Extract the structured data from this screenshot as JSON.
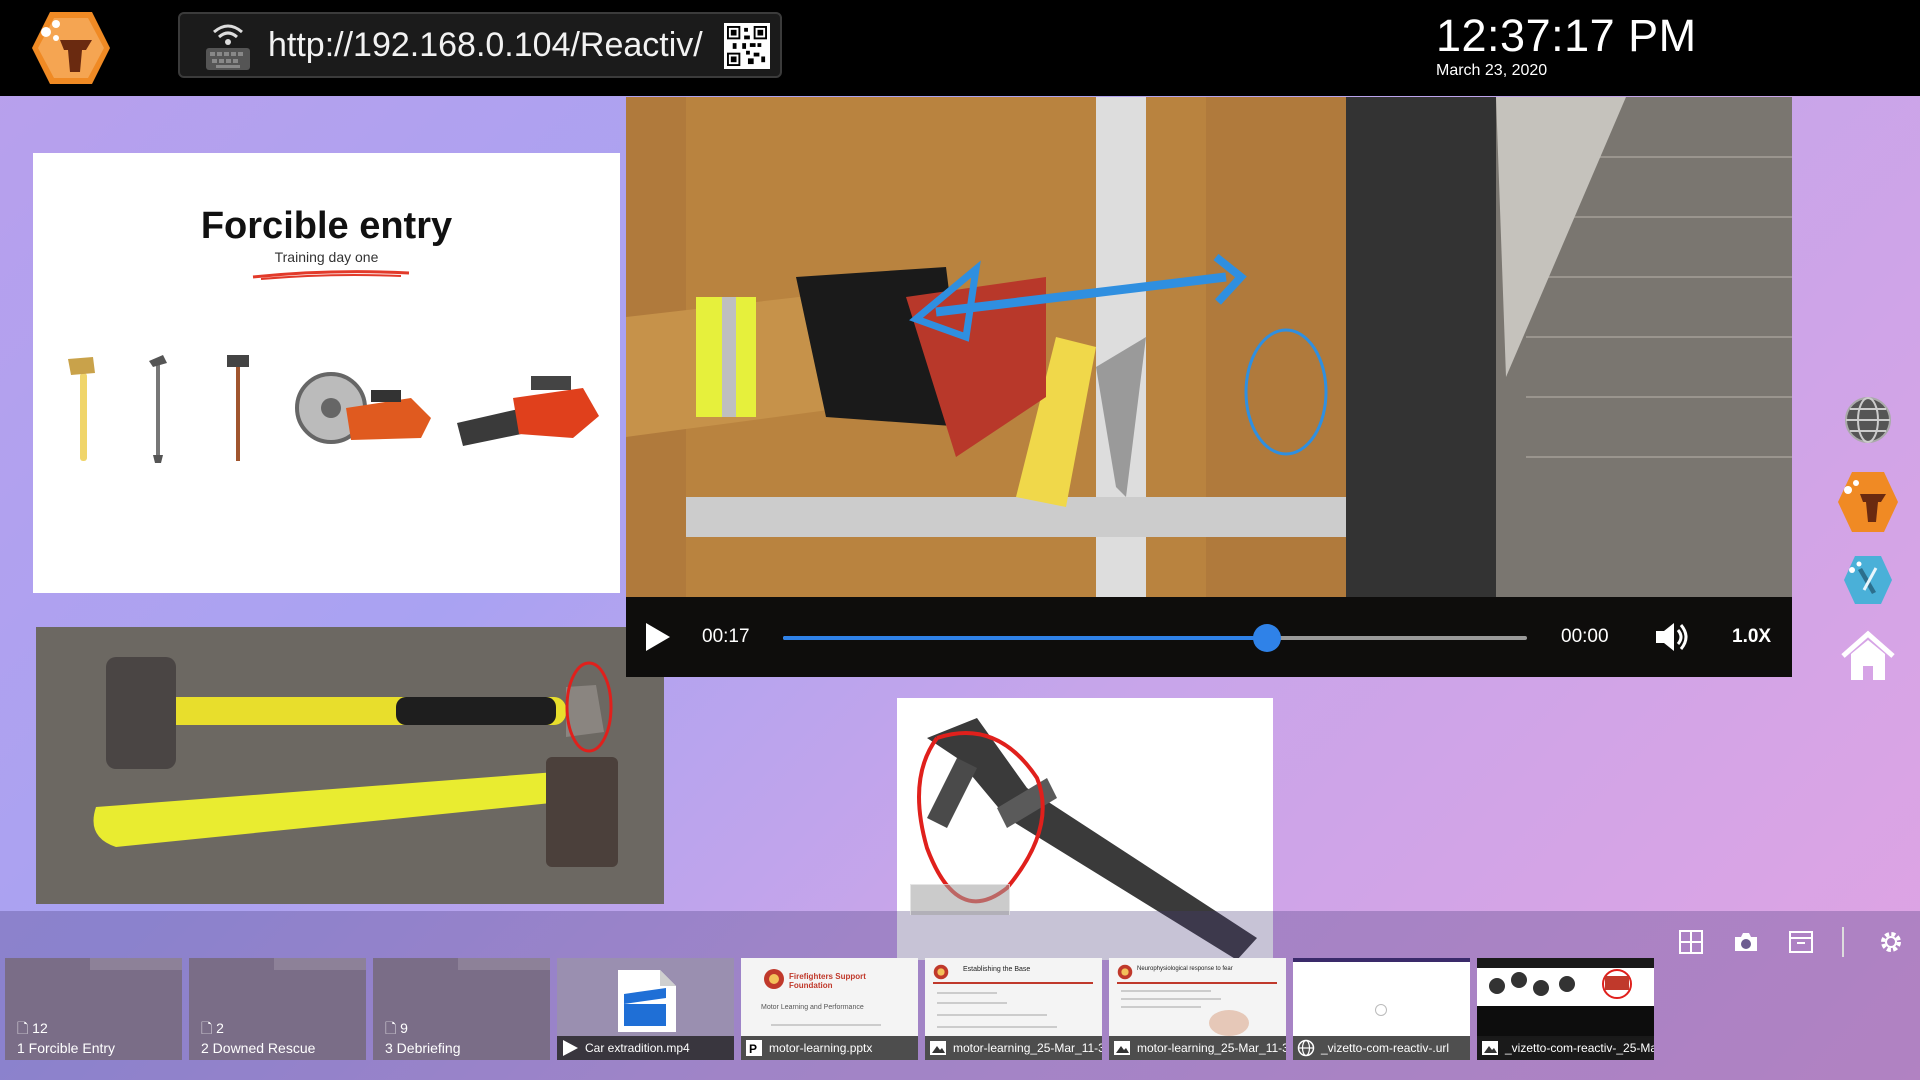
{
  "topbar": {
    "url": "http://192.168.0.104/Reactiv/",
    "time": "12:37:17 PM",
    "date": "March 23, 2020"
  },
  "slide": {
    "title": "Forcible entry",
    "subtitle": "Training day one"
  },
  "video": {
    "current_time": "00:17",
    "total_time": "00:00",
    "speed": "1.0X",
    "progress_percent": 65
  },
  "tray": {
    "folders": [
      {
        "count": "12",
        "name": "1 Forcible Entry"
      },
      {
        "count": "2",
        "name": "2 Downed Rescue"
      },
      {
        "count": "9",
        "name": "3 Debriefing"
      }
    ],
    "files": [
      {
        "name": "Car extradition.mp4",
        "icon": "play-icon"
      },
      {
        "name": "motor-learning.pptx",
        "icon": "powerpoint-icon"
      },
      {
        "name": "motor-learning_25-Mar_11-3",
        "icon": "image-icon"
      },
      {
        "name": "motor-learning_25-Mar_11-3",
        "icon": "image-icon"
      },
      {
        "name": "_vizetto-com-reactiv-.url",
        "icon": "globe-icon"
      },
      {
        "name": "_vizetto-com-reactiv-_25-Ma",
        "icon": "image-icon"
      }
    ],
    "thumb_text": {
      "ff_title": "Firefighters Support Foundation",
      "ff_sub": "Motor Learning and Performance",
      "base_title": "Establishing the Base",
      "neuro_title": "Neurophysiological response to fear"
    }
  },
  "colors": {
    "accent_blue": "#2f82e8",
    "logo_orange": "#f08a24",
    "topbar": "#000000"
  }
}
